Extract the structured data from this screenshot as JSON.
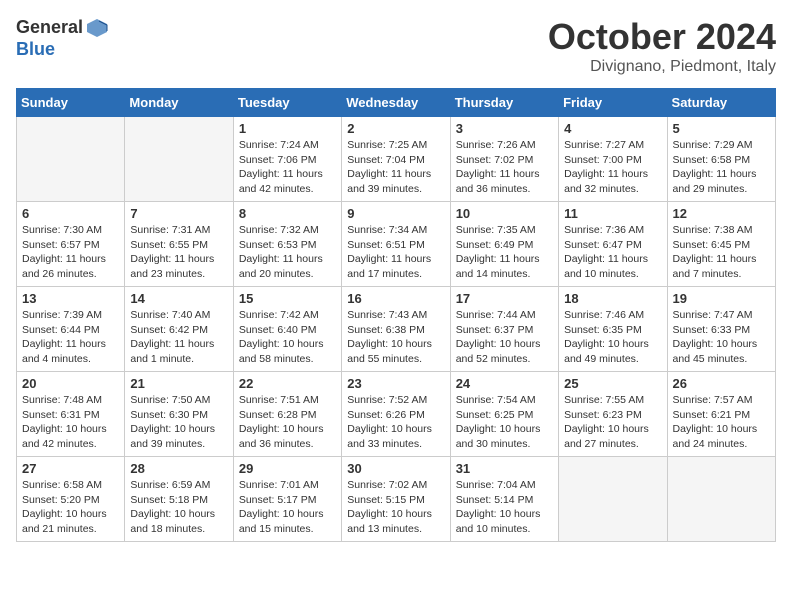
{
  "header": {
    "logo_general": "General",
    "logo_blue": "Blue",
    "month_title": "October 2024",
    "location": "Divignano, Piedmont, Italy"
  },
  "weekdays": [
    "Sunday",
    "Monday",
    "Tuesday",
    "Wednesday",
    "Thursday",
    "Friday",
    "Saturday"
  ],
  "weeks": [
    [
      {
        "day": "",
        "info": ""
      },
      {
        "day": "",
        "info": ""
      },
      {
        "day": "1",
        "info": "Sunrise: 7:24 AM\nSunset: 7:06 PM\nDaylight: 11 hours\nand 42 minutes."
      },
      {
        "day": "2",
        "info": "Sunrise: 7:25 AM\nSunset: 7:04 PM\nDaylight: 11 hours\nand 39 minutes."
      },
      {
        "day": "3",
        "info": "Sunrise: 7:26 AM\nSunset: 7:02 PM\nDaylight: 11 hours\nand 36 minutes."
      },
      {
        "day": "4",
        "info": "Sunrise: 7:27 AM\nSunset: 7:00 PM\nDaylight: 11 hours\nand 32 minutes."
      },
      {
        "day": "5",
        "info": "Sunrise: 7:29 AM\nSunset: 6:58 PM\nDaylight: 11 hours\nand 29 minutes."
      }
    ],
    [
      {
        "day": "6",
        "info": "Sunrise: 7:30 AM\nSunset: 6:57 PM\nDaylight: 11 hours\nand 26 minutes."
      },
      {
        "day": "7",
        "info": "Sunrise: 7:31 AM\nSunset: 6:55 PM\nDaylight: 11 hours\nand 23 minutes."
      },
      {
        "day": "8",
        "info": "Sunrise: 7:32 AM\nSunset: 6:53 PM\nDaylight: 11 hours\nand 20 minutes."
      },
      {
        "day": "9",
        "info": "Sunrise: 7:34 AM\nSunset: 6:51 PM\nDaylight: 11 hours\nand 17 minutes."
      },
      {
        "day": "10",
        "info": "Sunrise: 7:35 AM\nSunset: 6:49 PM\nDaylight: 11 hours\nand 14 minutes."
      },
      {
        "day": "11",
        "info": "Sunrise: 7:36 AM\nSunset: 6:47 PM\nDaylight: 11 hours\nand 10 minutes."
      },
      {
        "day": "12",
        "info": "Sunrise: 7:38 AM\nSunset: 6:45 PM\nDaylight: 11 hours\nand 7 minutes."
      }
    ],
    [
      {
        "day": "13",
        "info": "Sunrise: 7:39 AM\nSunset: 6:44 PM\nDaylight: 11 hours\nand 4 minutes."
      },
      {
        "day": "14",
        "info": "Sunrise: 7:40 AM\nSunset: 6:42 PM\nDaylight: 11 hours\nand 1 minute."
      },
      {
        "day": "15",
        "info": "Sunrise: 7:42 AM\nSunset: 6:40 PM\nDaylight: 10 hours\nand 58 minutes."
      },
      {
        "day": "16",
        "info": "Sunrise: 7:43 AM\nSunset: 6:38 PM\nDaylight: 10 hours\nand 55 minutes."
      },
      {
        "day": "17",
        "info": "Sunrise: 7:44 AM\nSunset: 6:37 PM\nDaylight: 10 hours\nand 52 minutes."
      },
      {
        "day": "18",
        "info": "Sunrise: 7:46 AM\nSunset: 6:35 PM\nDaylight: 10 hours\nand 49 minutes."
      },
      {
        "day": "19",
        "info": "Sunrise: 7:47 AM\nSunset: 6:33 PM\nDaylight: 10 hours\nand 45 minutes."
      }
    ],
    [
      {
        "day": "20",
        "info": "Sunrise: 7:48 AM\nSunset: 6:31 PM\nDaylight: 10 hours\nand 42 minutes."
      },
      {
        "day": "21",
        "info": "Sunrise: 7:50 AM\nSunset: 6:30 PM\nDaylight: 10 hours\nand 39 minutes."
      },
      {
        "day": "22",
        "info": "Sunrise: 7:51 AM\nSunset: 6:28 PM\nDaylight: 10 hours\nand 36 minutes."
      },
      {
        "day": "23",
        "info": "Sunrise: 7:52 AM\nSunset: 6:26 PM\nDaylight: 10 hours\nand 33 minutes."
      },
      {
        "day": "24",
        "info": "Sunrise: 7:54 AM\nSunset: 6:25 PM\nDaylight: 10 hours\nand 30 minutes."
      },
      {
        "day": "25",
        "info": "Sunrise: 7:55 AM\nSunset: 6:23 PM\nDaylight: 10 hours\nand 27 minutes."
      },
      {
        "day": "26",
        "info": "Sunrise: 7:57 AM\nSunset: 6:21 PM\nDaylight: 10 hours\nand 24 minutes."
      }
    ],
    [
      {
        "day": "27",
        "info": "Sunrise: 6:58 AM\nSunset: 5:20 PM\nDaylight: 10 hours\nand 21 minutes."
      },
      {
        "day": "28",
        "info": "Sunrise: 6:59 AM\nSunset: 5:18 PM\nDaylight: 10 hours\nand 18 minutes."
      },
      {
        "day": "29",
        "info": "Sunrise: 7:01 AM\nSunset: 5:17 PM\nDaylight: 10 hours\nand 15 minutes."
      },
      {
        "day": "30",
        "info": "Sunrise: 7:02 AM\nSunset: 5:15 PM\nDaylight: 10 hours\nand 13 minutes."
      },
      {
        "day": "31",
        "info": "Sunrise: 7:04 AM\nSunset: 5:14 PM\nDaylight: 10 hours\nand 10 minutes."
      },
      {
        "day": "",
        "info": ""
      },
      {
        "day": "",
        "info": ""
      }
    ]
  ]
}
